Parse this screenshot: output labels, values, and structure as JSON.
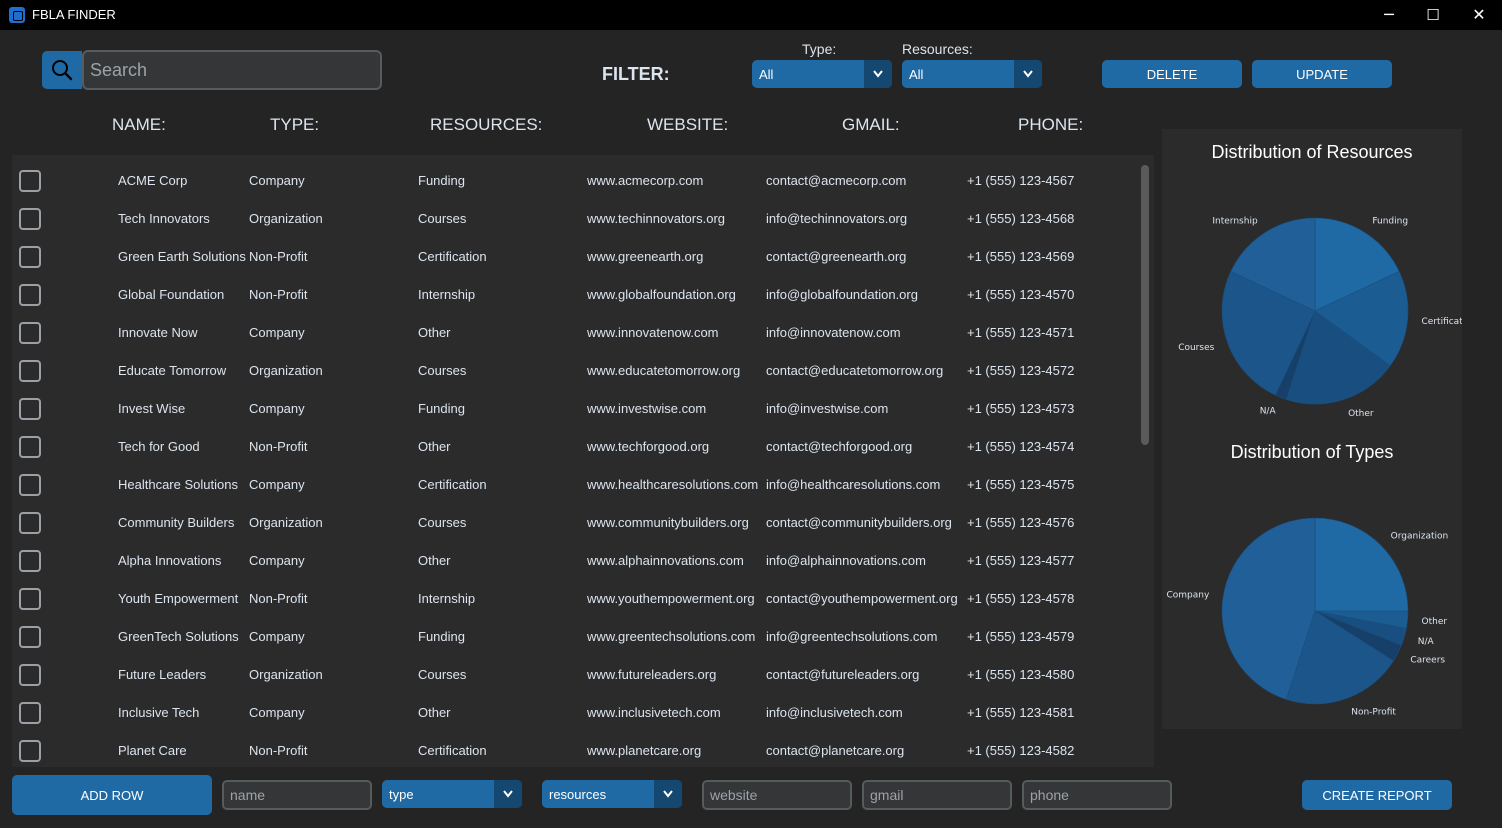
{
  "window": {
    "title": "FBLA FINDER",
    "minimize": "─",
    "maximize": "☐",
    "close": "✕"
  },
  "search": {
    "placeholder": "Search"
  },
  "filter": {
    "label": "FILTER:",
    "type_label": "Type:",
    "type_value": "All",
    "resources_label": "Resources:",
    "resources_value": "All"
  },
  "actions": {
    "delete": "DELETE",
    "update": "UPDATE",
    "add_row": "ADD ROW",
    "create_report": "CREATE REPORT"
  },
  "columns": [
    "NAME:",
    "TYPE:",
    "RESOURCES:",
    "WEBSITE:",
    "GMAIL:",
    "PHONE:"
  ],
  "rows": [
    [
      "ACME Corp",
      "Company",
      "Funding",
      "www.acmecorp.com",
      "contact@acmecorp.com",
      "+1 (555) 123-4567"
    ],
    [
      "Tech Innovators",
      "Organization",
      "Courses",
      "www.techinnovators.org",
      "info@techinnovators.org",
      "+1 (555) 123-4568"
    ],
    [
      "Green Earth Solutions",
      "Non-Profit",
      "Certification",
      "www.greenearth.org",
      "contact@greenearth.org",
      "+1 (555) 123-4569"
    ],
    [
      "Global Foundation",
      "Non-Profit",
      "Internship",
      "www.globalfoundation.org",
      "info@globalfoundation.org",
      "+1 (555) 123-4570"
    ],
    [
      "Innovate Now",
      "Company",
      "Other",
      "www.innovatenow.com",
      "info@innovatenow.com",
      "+1 (555) 123-4571"
    ],
    [
      "Educate Tomorrow",
      "Organization",
      "Courses",
      "www.educatetomorrow.org",
      "contact@educatetomorrow.org",
      "+1 (555) 123-4572"
    ],
    [
      "Invest Wise",
      "Company",
      "Funding",
      "www.investwise.com",
      "info@investwise.com",
      "+1 (555) 123-4573"
    ],
    [
      "Tech for Good",
      "Non-Profit",
      "Other",
      "www.techforgood.org",
      "contact@techforgood.org",
      "+1 (555) 123-4574"
    ],
    [
      "Healthcare Solutions",
      "Company",
      "Certification",
      "www.healthcaresolutions.com",
      "info@healthcaresolutions.com",
      "+1 (555) 123-4575"
    ],
    [
      "Community Builders",
      "Organization",
      "Courses",
      "www.communitybuilders.org",
      "contact@communitybuilders.org",
      "+1 (555) 123-4576"
    ],
    [
      "Alpha Innovations",
      "Company",
      "Other",
      "www.alphainnovations.com",
      "info@alphainnovations.com",
      "+1 (555) 123-4577"
    ],
    [
      "Youth Empowerment",
      "Non-Profit",
      "Internship",
      "www.youthempowerment.org",
      "contact@youthempowerment.org",
      "+1 (555) 123-4578"
    ],
    [
      "GreenTech Solutions",
      "Company",
      "Funding",
      "www.greentechsolutions.com",
      "info@greentechsolutions.com",
      "+1 (555) 123-4579"
    ],
    [
      "Future Leaders",
      "Organization",
      "Courses",
      "www.futureleaders.org",
      "contact@futureleaders.org",
      "+1 (555) 123-4580"
    ],
    [
      "Inclusive Tech",
      "Company",
      "Other",
      "www.inclusivetech.com",
      "info@inclusivetech.com",
      "+1 (555) 123-4581"
    ],
    [
      "Planet Care",
      "Non-Profit",
      "Certification",
      "www.planetcare.org",
      "contact@planetcare.org",
      "+1 (555) 123-4582"
    ]
  ],
  "new_row": {
    "name_placeholder": "name",
    "type_value": "type",
    "resources_value": "resources",
    "website_placeholder": "website",
    "gmail_placeholder": "gmail",
    "phone_placeholder": "phone"
  },
  "chart_data": [
    {
      "type": "pie",
      "title": "Distribution of Resources",
      "categories": [
        "Funding",
        "Certification",
        "Other",
        "N/A",
        "Courses",
        "Internship"
      ],
      "values": [
        18,
        17,
        20,
        2,
        25,
        18
      ]
    },
    {
      "type": "pie",
      "title": "Distribution of Types",
      "categories": [
        "Organization",
        "Other",
        "N/A",
        "Careers",
        "Non-Profit",
        "Company"
      ],
      "values": [
        25,
        3,
        3,
        3,
        21,
        45
      ]
    }
  ],
  "colors": {
    "accent": "#1f6aa5",
    "accent_dark": "#144870",
    "background": "#242424",
    "panel": "#2b2b2b"
  }
}
